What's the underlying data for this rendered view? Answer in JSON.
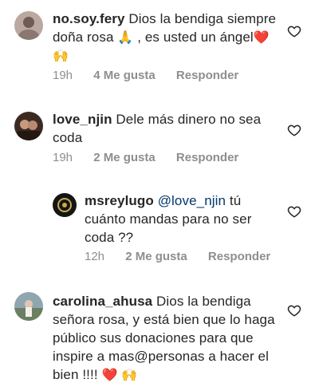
{
  "comments": [
    {
      "username": "no.soy.fery",
      "text_before": "Dios la bendiga siempre doña rosa ",
      "emoji1": "🙏",
      "text_after": " , es usted un ángel",
      "emoji2": "❤️",
      "emoji3": "🙌",
      "time": "19h",
      "likes": "4 Me gusta",
      "reply": "Responder"
    },
    {
      "username": "love_njin",
      "text": "Dele más dinero no sea coda",
      "time": "19h",
      "likes": "2 Me gusta",
      "reply": "Responder"
    },
    {
      "username": "msreylugo",
      "mention": "@love_njin",
      "text": "tú cuánto mandas para no ser coda ??",
      "time": "12h",
      "likes": "2 Me gusta",
      "reply": "Responder"
    },
    {
      "username": "carolina_ahusa",
      "text": "Dios la bendiga señora rosa, y está bien que lo haga público sus donaciones para que inspire a mas@personas a hacer el bien !!!! ",
      "emoji1": "❤️",
      "emoji2": "🙌",
      "time": "",
      "likes": "",
      "reply": ""
    }
  ],
  "colors": {
    "text": "#262626",
    "meta": "#8e8e8e",
    "mention": "#00376b",
    "heart_outline": "#262626"
  },
  "icons": [
    "heart-outline-icon",
    "avatar"
  ]
}
